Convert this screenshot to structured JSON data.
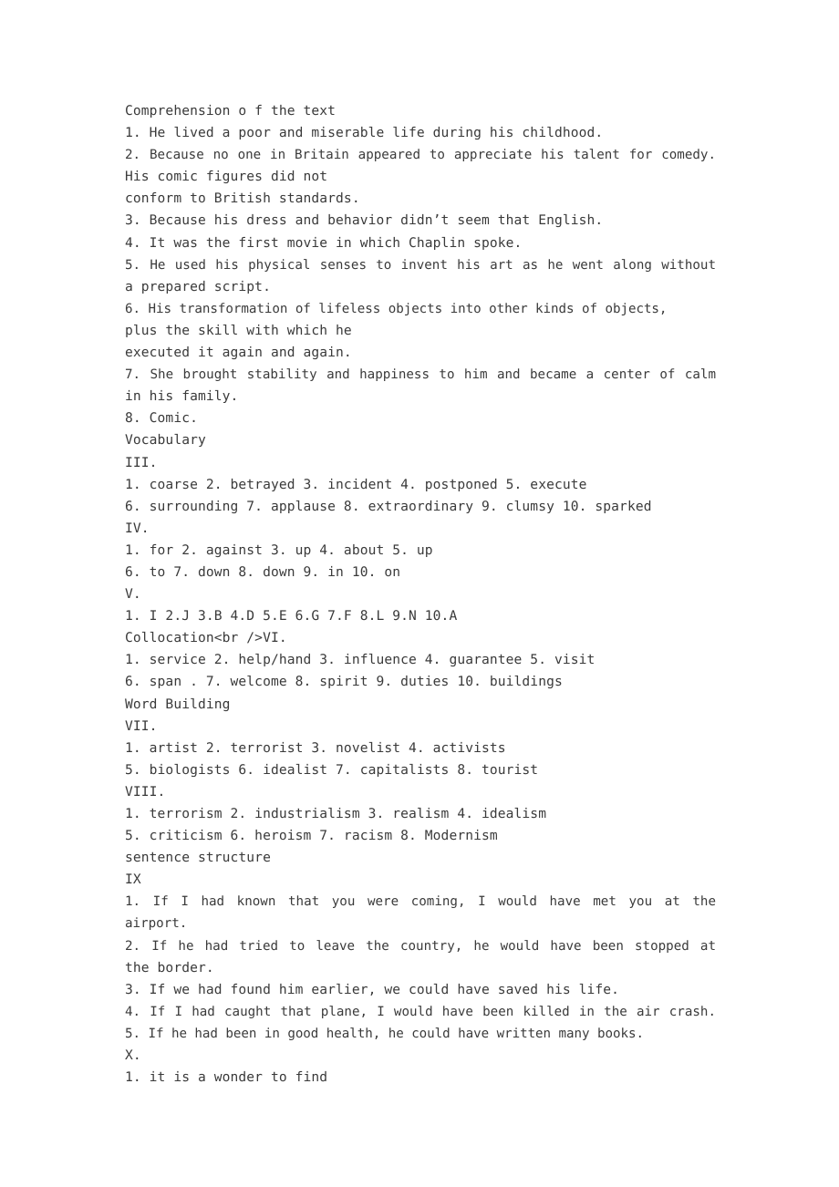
{
  "document": {
    "text_color": "#3a3a3a",
    "background_color": "#ffffff",
    "lines": [
      {
        "id": "l01",
        "text": "Comprehension o f the text",
        "style": "normal"
      },
      {
        "id": "l02",
        "text": "1. He lived a poor and miserable life during his childhood.",
        "style": "normal"
      },
      {
        "id": "l03",
        "text": "2. Because no one in Britain appeared to appreciate his talent for comedy.",
        "style": "justified"
      },
      {
        "id": "l04",
        "text": "His comic figures did not",
        "style": "normal"
      },
      {
        "id": "l05",
        "text": "conform to British standards.",
        "style": "normal"
      },
      {
        "id": "l06",
        "text": "3. Because his dress and behavior didn’t seem that English.",
        "style": "normal"
      },
      {
        "id": "l07",
        "text": "4. It was the first movie in which Chaplin spoke.",
        "style": "normal"
      },
      {
        "id": "l08",
        "text": "5. He used his physical senses to invent his art as he went along without",
        "style": "justified"
      },
      {
        "id": "l09",
        "text": "a prepared script.",
        "style": "normal"
      },
      {
        "id": "l10",
        "text": "6. His transformation of lifeless objects into other kinds of objects,",
        "style": "tight"
      },
      {
        "id": "l11",
        "text": "plus the skill with which he",
        "style": "normal"
      },
      {
        "id": "l12",
        "text": "executed it again and again.",
        "style": "normal"
      },
      {
        "id": "l13",
        "text": "7. She brought stability and happiness to him and became a center of calm",
        "style": "justified"
      },
      {
        "id": "l14",
        "text": "in his family.",
        "style": "normal"
      },
      {
        "id": "l15",
        "text": "8. Comic.",
        "style": "normal"
      },
      {
        "id": "l16",
        "text": "Vocabulary",
        "style": "normal"
      },
      {
        "id": "l17",
        "text": "III.",
        "style": "normal"
      },
      {
        "id": "l18",
        "text": "1. coarse 2. betrayed 3. incident 4. postponed 5. execute",
        "style": "normal"
      },
      {
        "id": "l19",
        "text": "6. surrounding 7. applause 8. extraordinary 9. clumsy 10. sparked",
        "style": "normal"
      },
      {
        "id": "l20",
        "text": "IV.",
        "style": "normal"
      },
      {
        "id": "l21",
        "text": "1. for 2. against 3. up 4. about 5. up",
        "style": "normal"
      },
      {
        "id": "l22",
        "text": "6. to 7. down 8. down 9. in 10. on",
        "style": "normal"
      },
      {
        "id": "l23",
        "text": "V.",
        "style": "normal"
      },
      {
        "id": "l24",
        "text": "1. I 2.J 3.B 4.D 5.E 6.G 7.F 8.L 9.N 10.A",
        "style": "normal"
      },
      {
        "id": "l25",
        "text": "Collocation<br />VI.",
        "style": "normal"
      },
      {
        "id": "l26",
        "text": "1. service 2. help/hand 3. influence 4. guarantee 5. visit",
        "style": "normal"
      },
      {
        "id": "l27",
        "text": "6. span . 7. welcome 8. spirit 9. duties 10. buildings",
        "style": "normal"
      },
      {
        "id": "l28",
        "text": "Word Building",
        "style": "normal"
      },
      {
        "id": "l29",
        "text": "VII.",
        "style": "normal"
      },
      {
        "id": "l30",
        "text": "1. artist 2. terrorist 3. novelist 4. activists",
        "style": "normal"
      },
      {
        "id": "l31",
        "text": "5. biologists 6. idealist 7. capitalists 8. tourist",
        "style": "normal"
      },
      {
        "id": "l32",
        "text": "VIII.",
        "style": "normal"
      },
      {
        "id": "l33",
        "text": "1. terrorism 2. industrialism 3. realism 4. idealism",
        "style": "normal"
      },
      {
        "id": "l34",
        "text": "5. criticism 6. heroism 7. racism 8. Modernism",
        "style": "normal"
      },
      {
        "id": "l35",
        "text": "sentence structure",
        "style": "normal"
      },
      {
        "id": "l36",
        "text": "IX",
        "style": "normal"
      },
      {
        "id": "l37",
        "text": "1. If I had known that you were coming, I would have met you at the airport.",
        "style": "justified"
      },
      {
        "id": "l38",
        "text": "2. If he had tried to leave the country, he would have been stopped at",
        "style": "justified"
      },
      {
        "id": "l39",
        "text": "the border.",
        "style": "normal"
      },
      {
        "id": "l40",
        "text": "3. If we had found him earlier, we could have saved his life.",
        "style": "normal"
      },
      {
        "id": "l41",
        "text": "4. If I had caught that plane, I would have been killed in the air crash.",
        "style": "justified"
      },
      {
        "id": "l42",
        "text": "5. If he had been in good health, he could have written many books.",
        "style": "tight"
      },
      {
        "id": "l43",
        "text": "X.",
        "style": "normal"
      },
      {
        "id": "l44",
        "text": "1. it is a wonder to find",
        "style": "normal"
      }
    ]
  }
}
